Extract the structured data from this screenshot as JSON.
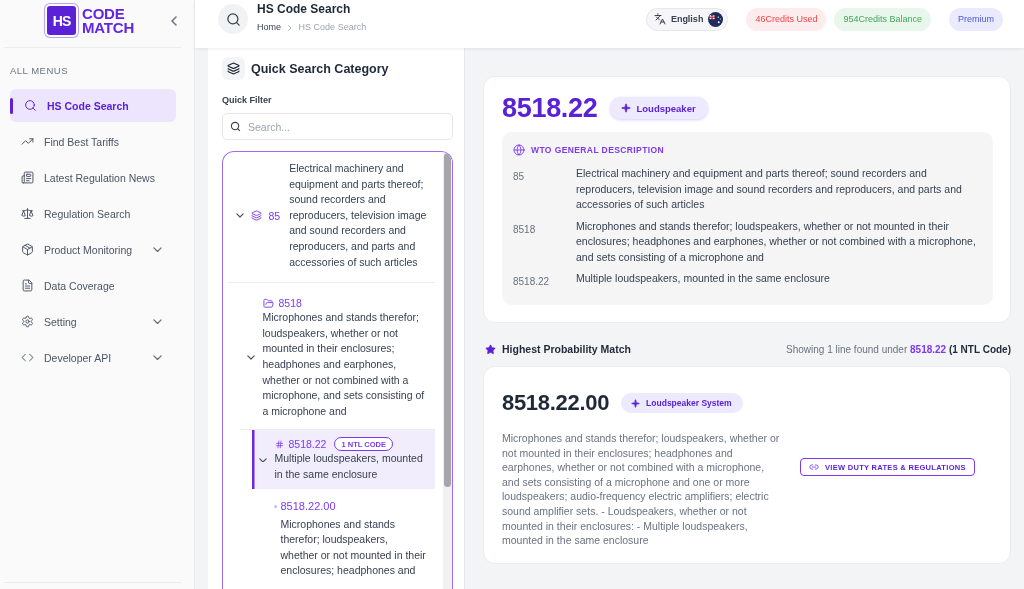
{
  "sidebar": {
    "logo": {
      "mark": "HS",
      "wordmark": [
        "CODE",
        "MATCH"
      ]
    },
    "section_label": "ALL MENUS",
    "items": [
      {
        "label": "HS Code Search",
        "selected": true,
        "has_submenu": false
      },
      {
        "label": "Find Best Tariffs",
        "selected": false,
        "has_submenu": false
      },
      {
        "label": "Latest Regulation News",
        "selected": false,
        "has_submenu": false
      },
      {
        "label": "Regulation Search",
        "selected": false,
        "has_submenu": false
      },
      {
        "label": "Product Monitoring",
        "selected": false,
        "has_submenu": true
      },
      {
        "label": "Data Coverage",
        "selected": false,
        "has_submenu": false
      },
      {
        "label": "Setting",
        "selected": false,
        "has_submenu": true
      },
      {
        "label": "Developer API",
        "selected": false,
        "has_submenu": true
      }
    ]
  },
  "header": {
    "title": "HS Code Search",
    "breadcrumb": [
      {
        "label": "Home",
        "current": false
      },
      {
        "label": "HS Code Search",
        "current": true
      }
    ],
    "language": "English",
    "badges": [
      {
        "kind": "credits_used",
        "text": "46Credits Used"
      },
      {
        "kind": "credits_balance",
        "text": "954Credits Balance"
      },
      {
        "kind": "plan",
        "text": "Premium"
      }
    ]
  },
  "quick_search": {
    "title": "Quick Search Category",
    "filter_label": "Quick Filter",
    "search": {
      "placeholder": "Search..."
    },
    "tree": [
      {
        "kind": "chapter",
        "code": "85",
        "description": "Electrical machinery and equipment and parts thereof; sound recorders and reproducers, television image and sound recorders and reproducers, and parts and accessories of such articles",
        "expanded": true,
        "selected": false,
        "children": [
          {
            "kind": "heading",
            "code": "8518",
            "description": "Microphones and stands therefor; loudspeakers, whether or not mounted in their enclosures; headphones and earphones, whether or not combined with a microphone, and sets consisting of a microphone and",
            "expanded": true,
            "selected": false,
            "children": [
              {
                "kind": "subheading",
                "code": "8518.22",
                "badge": "1 NTL CODE",
                "description": "Multiple loudspeakers, mounted in the same enclosure",
                "expanded": true,
                "selected": true,
                "children": [
                  {
                    "kind": "tariff_line",
                    "code": "8518.22.00",
                    "description": "Microphones and stands therefor; loudspeakers, whether or not mounted in their enclosures; headphones and",
                    "selected": false
                  }
                ]
              }
            ]
          }
        ]
      }
    ]
  },
  "subheading_card": {
    "code": "8518.22",
    "tag": "Loudspeaker",
    "description_title": "WTO GENERAL DESCRIPTION",
    "descriptions": [
      {
        "code": "85",
        "text": "Electrical machinery and equipment and parts thereof; sound recorders and reproducers, television image and sound recorders and reproducers, and parts and accessories of such articles"
      },
      {
        "code": "8518",
        "text": "Microphones and stands therefor; loudspeakers, whether or not mounted in their enclosures; headphones and earphones, whether or not combined with a microphone, and sets consisting of a microphone and"
      },
      {
        "code": "8518.22",
        "text": "Multiple loudspeakers, mounted in the same enclosure"
      }
    ]
  },
  "match_section": {
    "title": "Highest Probability Match",
    "summary": "Showing 1 line found under **8518.22** **(1 NTL Code)**",
    "results": [
      {
        "code": "8518.22.00",
        "tag": "Loudspeaker System",
        "description": "Microphones and stands therefor; loudspeakers, whether or not mounted in their enclosures; headphones and earphones, whether or not combined with a microphone, and sets consisting of a microphone and one or more loudspeakers; audio-frequency electric amplifiers; electric sound amplifier sets. - Loudspeakers, whether or not mounted in their enclosures: - Multiple loudspeakers, mounted in the same enclosure",
        "action": "VIEW DUTY RATES & REGULATIONS"
      }
    ]
  }
}
